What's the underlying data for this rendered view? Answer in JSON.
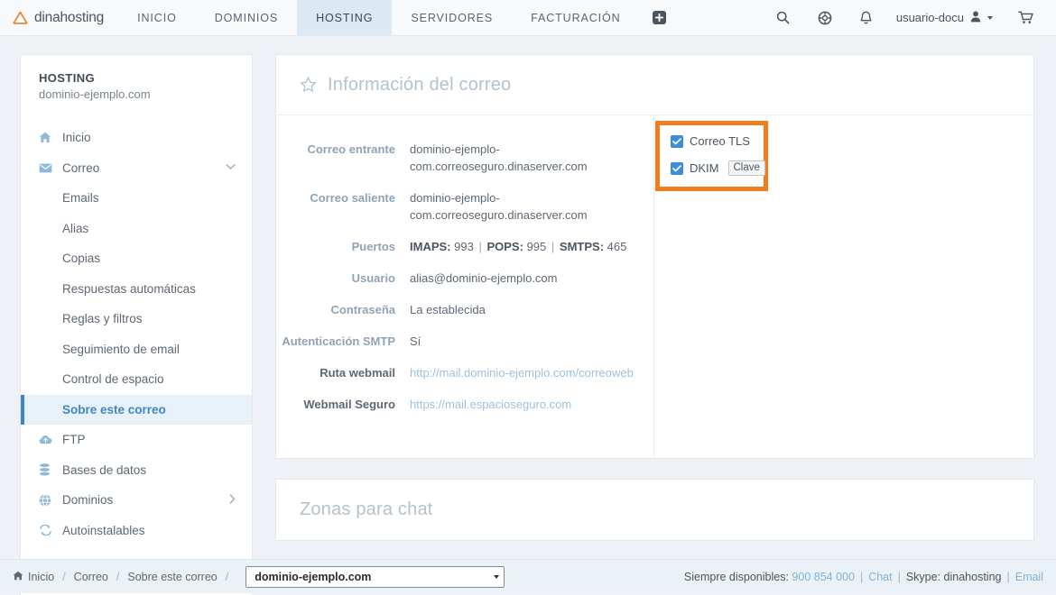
{
  "brand": {
    "name": "dinahosting",
    "logo_icon": "triangle-logo-icon",
    "accent": "#f07d1e"
  },
  "topnav": {
    "links": [
      {
        "label": "INICIO",
        "active": false
      },
      {
        "label": "DOMINIOS",
        "active": false
      },
      {
        "label": "HOSTING",
        "active": true
      },
      {
        "label": "SERVIDORES",
        "active": false
      },
      {
        "label": "FACTURACIÓN",
        "active": false
      }
    ],
    "add_icon": "plus-icon",
    "icons": [
      {
        "name": "search-icon"
      },
      {
        "name": "lifebuoy-icon"
      },
      {
        "name": "bell-icon"
      }
    ],
    "user": {
      "label": "usuario-docu",
      "icon": "user-icon",
      "caret": "chevron-down-icon"
    },
    "cart_icon": "cart-icon"
  },
  "sidebar": {
    "title": "HOSTING",
    "subtitle": "dominio-ejemplo.com",
    "items": [
      {
        "label": "Inicio",
        "icon": "home-icon",
        "sub": false,
        "active": false,
        "chevron": ""
      },
      {
        "label": "Correo",
        "icon": "envelope-icon",
        "sub": false,
        "active": false,
        "chevron": "down"
      },
      {
        "label": "Emails",
        "icon": "",
        "sub": true,
        "active": false,
        "chevron": ""
      },
      {
        "label": "Alias",
        "icon": "",
        "sub": true,
        "active": false,
        "chevron": ""
      },
      {
        "label": "Copias",
        "icon": "",
        "sub": true,
        "active": false,
        "chevron": ""
      },
      {
        "label": "Respuestas automáticas",
        "icon": "",
        "sub": true,
        "active": false,
        "chevron": ""
      },
      {
        "label": "Reglas y filtros",
        "icon": "",
        "sub": true,
        "active": false,
        "chevron": ""
      },
      {
        "label": "Seguimiento de email",
        "icon": "",
        "sub": true,
        "active": false,
        "chevron": ""
      },
      {
        "label": "Control de espacio",
        "icon": "",
        "sub": true,
        "active": false,
        "chevron": ""
      },
      {
        "label": "Sobre este correo",
        "icon": "",
        "sub": true,
        "active": true,
        "chevron": ""
      },
      {
        "label": "FTP",
        "icon": "cloud-upload-icon",
        "sub": false,
        "active": false,
        "chevron": ""
      },
      {
        "label": "Bases de datos",
        "icon": "database-icon",
        "sub": false,
        "active": false,
        "chevron": ""
      },
      {
        "label": "Dominios",
        "icon": "globe-icon",
        "sub": false,
        "active": false,
        "chevron": "right"
      },
      {
        "label": "Autoinstalables",
        "icon": "autoinstall-icon",
        "sub": false,
        "active": false,
        "chevron": ""
      }
    ]
  },
  "main": {
    "info_card": {
      "title": "Información del correo",
      "star_icon": "star-icon",
      "rows": [
        {
          "label": "Correo entrante",
          "value": "dominio-ejemplo-com.correoseguro.dinaserver.com",
          "style": "text",
          "label_dark": false
        },
        {
          "label": "Correo saliente",
          "value": "dominio-ejemplo-com.correoseguro.dinaserver.com",
          "style": "text",
          "label_dark": false
        },
        {
          "label": "Puertos",
          "value": "",
          "style": "ports",
          "label_dark": false
        },
        {
          "label": "Usuario",
          "value": "alias@dominio-ejemplo.com",
          "style": "text",
          "label_dark": false
        },
        {
          "label": "Contraseña",
          "value": "La establecida",
          "style": "text",
          "label_dark": false
        },
        {
          "label": "Autenticación SMTP",
          "value": "Sí",
          "style": "text",
          "label_dark": false
        },
        {
          "label": "Ruta webmail",
          "value": "http://mail.dominio-ejemplo.com/correoweb",
          "style": "link",
          "label_dark": true
        },
        {
          "label": "Webmail Seguro",
          "value": "https://mail.espacioseguro.com",
          "style": "link",
          "label_dark": true
        }
      ],
      "ports": [
        {
          "name": "IMAPS:",
          "port": "993"
        },
        {
          "name": "POPS:",
          "port": "995"
        },
        {
          "name": "SMTPS:",
          "port": "465"
        }
      ],
      "highlight": {
        "border_color": "#f07d1e",
        "options": [
          {
            "label": "Correo TLS",
            "checked": true,
            "button": ""
          },
          {
            "label": "DKIM",
            "checked": true,
            "button": "Clave"
          }
        ]
      }
    },
    "chat_card": {
      "title": "Zonas para chat"
    }
  },
  "footer": {
    "breadcrumbs": [
      {
        "label": "Inicio",
        "icon": "home-icon"
      },
      {
        "label": "Correo",
        "icon": ""
      },
      {
        "label": "Sobre este correo",
        "icon": ""
      }
    ],
    "domain_select": {
      "value": "dominio-ejemplo.com"
    },
    "support": {
      "prefix": "Siempre disponibles:",
      "phone": "900 854 000",
      "chat": "Chat",
      "skype": "Skype: dinahosting",
      "email": "Email"
    }
  }
}
